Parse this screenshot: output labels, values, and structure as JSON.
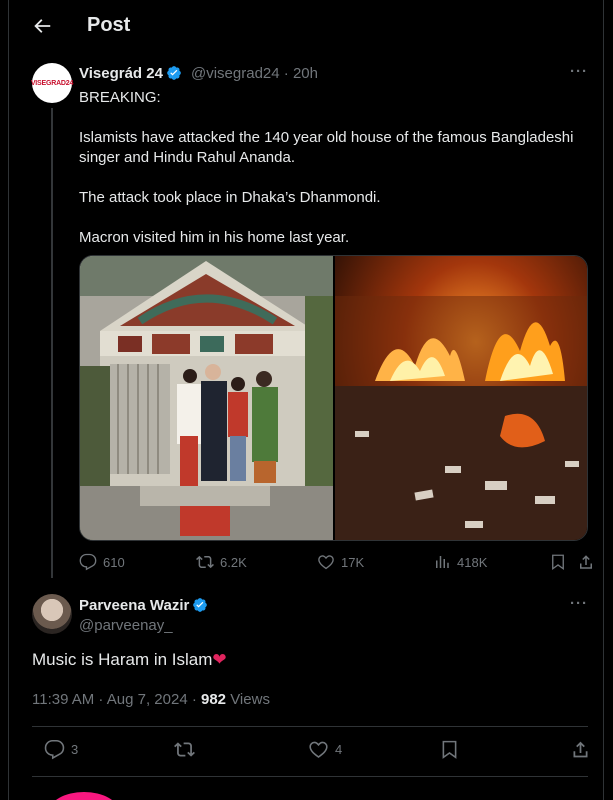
{
  "header": {
    "title": "Post"
  },
  "original_post": {
    "author": "Visegrád 24",
    "avatar_text": "VISEGRAD24",
    "handle": "@visegrad24",
    "time": "20h",
    "paragraphs": [
      "BREAKING:",
      "Islamists have attacked the 140 year old house of the famous Bangladeshi singer and Hindu Rahul Ananda.",
      "The attack took place in Dhaka’s Dhanmondi.",
      "Macron visited him in his home last year."
    ],
    "stats": {
      "replies": "610",
      "reposts": "6.2K",
      "likes": "17K",
      "views": "418K"
    }
  },
  "reply": {
    "author": "Parveena Wazir",
    "handle": "@parveenay_",
    "text": "Music is Haram in Islam",
    "heart": "❤",
    "time": "11:39 AM · Aug 7, 2024 · ",
    "views_count": "982",
    "views_label": " Views",
    "stats": {
      "replies": "3",
      "likes": "4"
    }
  },
  "colors": {
    "background": "#000000",
    "text": "#e7e9ea",
    "muted": "#71767b",
    "verified": "#1d9bf0",
    "border": "#2f3336"
  },
  "icons": [
    "back-arrow-icon",
    "verified-badge-icon",
    "more-icon",
    "reply-icon",
    "repost-icon",
    "like-icon",
    "views-icon",
    "bookmark-icon",
    "share-icon"
  ]
}
